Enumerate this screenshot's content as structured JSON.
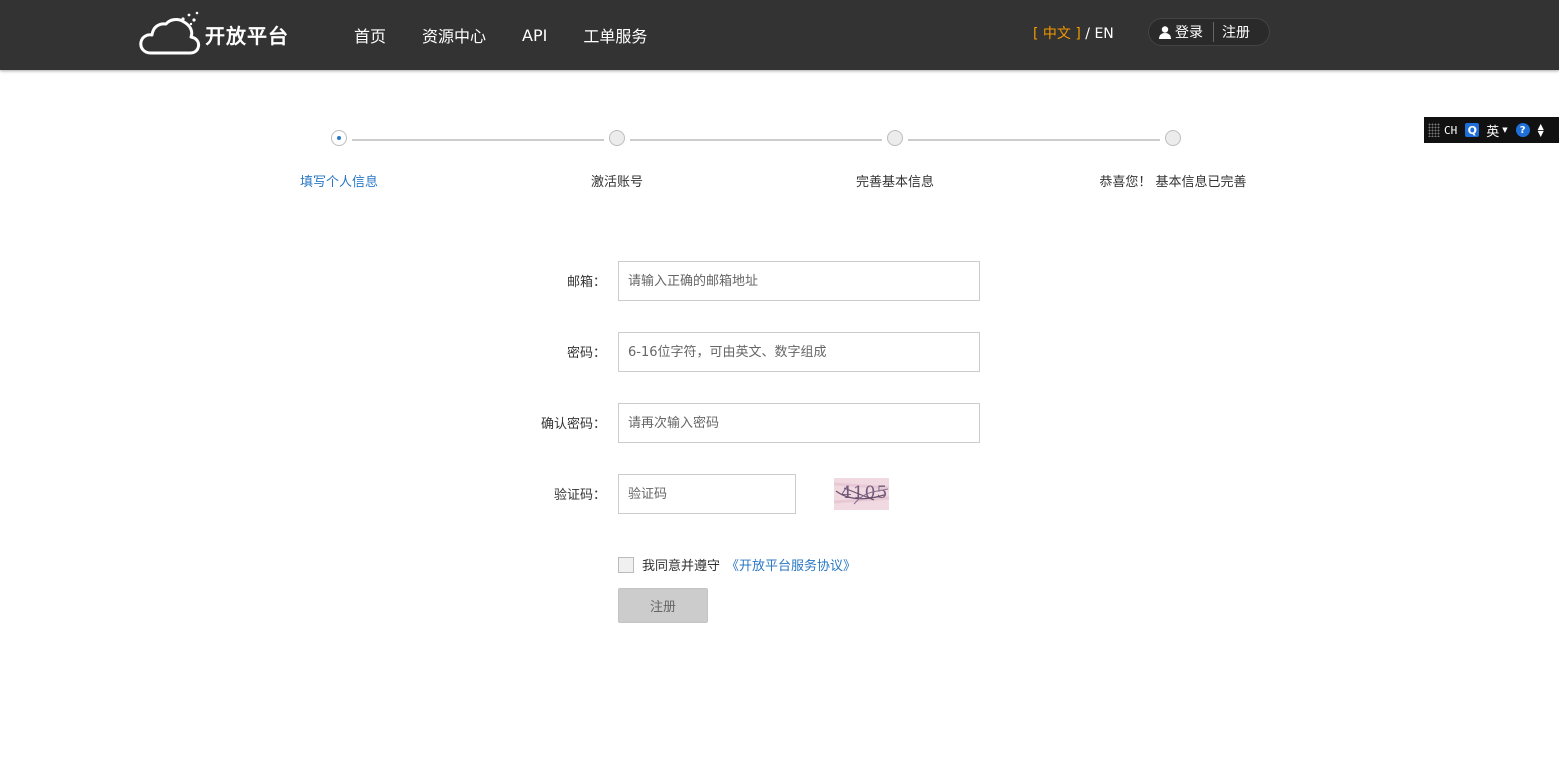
{
  "header": {
    "brand": "开放平台",
    "nav": [
      "首页",
      "资源中心",
      "API",
      "工单服务"
    ],
    "lang_active": "[ 中文 ]",
    "lang_sep": " / ",
    "lang_other": "EN",
    "login_label": "登录",
    "register_label": "注册"
  },
  "ime": {
    "ch": "CH",
    "q": "Q",
    "mode": "英",
    "help": "?"
  },
  "steps": {
    "items": [
      "填写个人信息",
      "激活账号",
      "完善基本信息",
      "恭喜您！ 基本信息已完善"
    ],
    "current": 1
  },
  "form": {
    "email_label": "邮箱：",
    "email_placeholder": "请输入正确的邮箱地址",
    "password_label": "密码：",
    "password_placeholder": "6-16位字符，可由英文、数字组成",
    "confirm_label": "确认密码：",
    "confirm_placeholder": "请再次输入密码",
    "captcha_label": "验证码：",
    "captcha_placeholder": "验证码",
    "captcha_text": "4105",
    "agree_text": "我同意并遵守",
    "agree_link": "《开放平台服务协议》",
    "submit_label": "注册"
  },
  "colors": {
    "header_bg": "#333333",
    "accent": "#2a78c4",
    "lang_active": "#f39800"
  }
}
